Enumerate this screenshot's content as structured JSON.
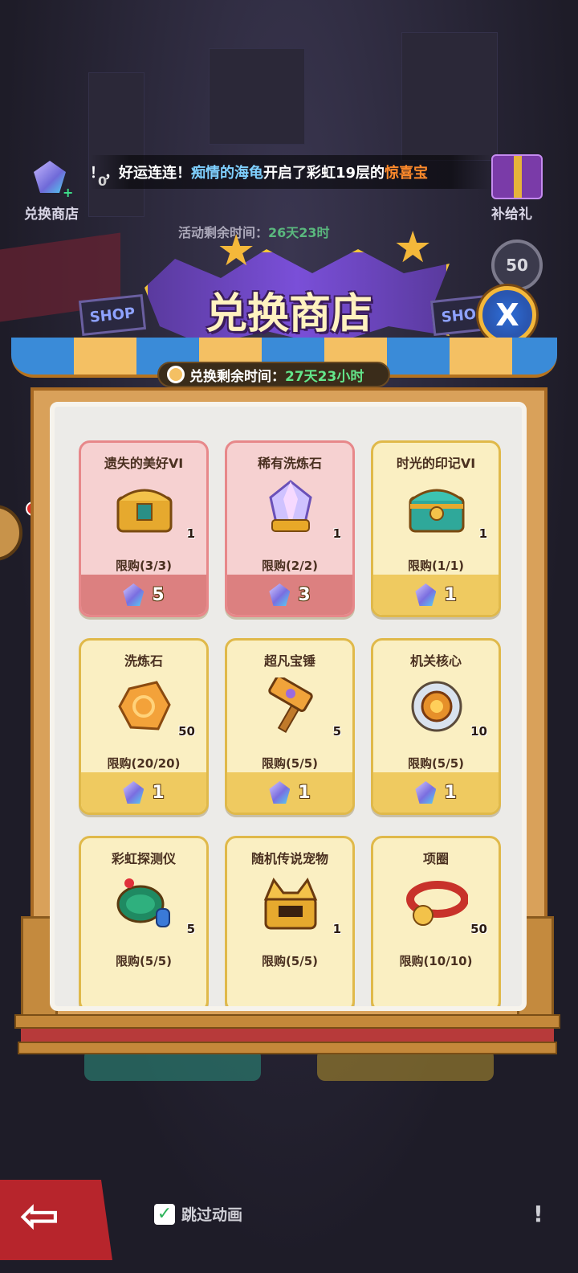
{
  "top": {
    "exchange_label": "兑换商店",
    "gem_count": "0",
    "ticker": {
      "prefix": "！，好运连连！",
      "player": "痴情的海龟",
      "middle": "开启了彩虹19层的",
      "reward": "惊喜宝"
    },
    "gift_label": "补给礼",
    "activity_timer_label": "活动剩余时间：",
    "activity_timer_value": "26天23时",
    "level": "50"
  },
  "header": {
    "title": "兑换商店",
    "shop_sign": "SHOP",
    "close_symbol": "X"
  },
  "exchange_timer": {
    "label": "兑换剩余时间：",
    "value": "27天23小时"
  },
  "items": [
    {
      "name": "遗失的美好VI",
      "qty": "1",
      "limit": "限购(3/3)",
      "cost": "5",
      "style": "red",
      "icon": "golden-chest-icon"
    },
    {
      "name": "稀有洗炼石",
      "qty": "1",
      "limit": "限购(2/2)",
      "cost": "3",
      "style": "red",
      "icon": "crystal-gem-icon"
    },
    {
      "name": "时光的印记VI",
      "qty": "1",
      "limit": "限购(1/1)",
      "cost": "1",
      "style": "yellow",
      "icon": "teal-chest-icon"
    },
    {
      "name": "洗炼石",
      "qty": "50",
      "limit": "限购(20/20)",
      "cost": "1",
      "style": "yellow",
      "icon": "amber-stone-icon"
    },
    {
      "name": "超凡宝锤",
      "qty": "5",
      "limit": "限购(5/5)",
      "cost": "1",
      "style": "yellow",
      "icon": "hammer-icon"
    },
    {
      "name": "机关核心",
      "qty": "10",
      "limit": "限购(5/5)",
      "cost": "1",
      "style": "yellow",
      "icon": "mech-core-icon"
    },
    {
      "name": "彩虹探测仪",
      "qty": "5",
      "limit": "限购(5/5)",
      "cost": "",
      "style": "yellow",
      "icon": "detector-icon"
    },
    {
      "name": "随机传说宠物",
      "qty": "1",
      "limit": "限购(5/5)",
      "cost": "",
      "style": "yellow",
      "icon": "pet-chest-icon"
    },
    {
      "name": "项圈",
      "qty": "50",
      "limit": "限购(10/10)",
      "cost": "",
      "style": "yellow",
      "icon": "collar-icon"
    }
  ],
  "bottom": {
    "skip_label": "跳过动画",
    "back_symbol": "⇦",
    "alert_symbol": "!"
  },
  "colors": {
    "accent_green": "#63e58a",
    "player_blue": "#7fd0ff",
    "reward_orange": "#ff8a2b",
    "card_red": "#dc8080",
    "card_yellow": "#efca60"
  }
}
